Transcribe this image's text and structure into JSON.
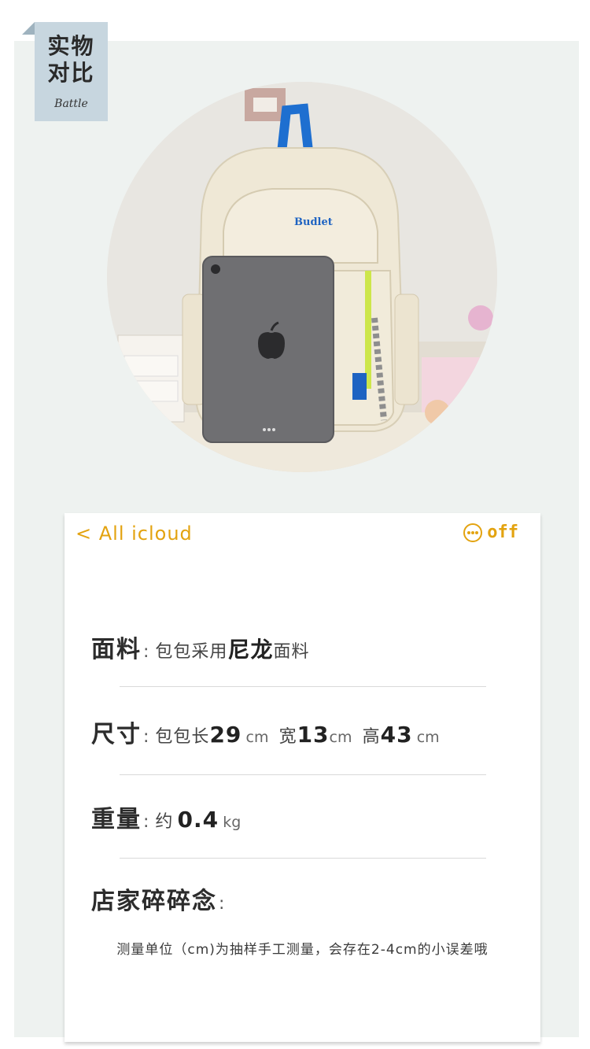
{
  "tag": {
    "title_line1": "实物",
    "title_line2": "对比",
    "subtitle": "Battle"
  },
  "nav": {
    "back_label": "< All icloud",
    "more_icon": "more-circle-icon",
    "off_label": "off"
  },
  "specs": {
    "material": {
      "label": "面料",
      "sep": ":",
      "text1": "包包采用",
      "highlight": "尼龙",
      "text2": "面料"
    },
    "size": {
      "label": "尺寸",
      "sep": ":",
      "length_label": "包包长",
      "length_value": "29",
      "length_unit": "cm",
      "width_label": "宽",
      "width_value": "13",
      "width_unit": "cm",
      "height_label": "高",
      "height_value": "43",
      "height_unit": "cm"
    },
    "weight": {
      "label": "重量",
      "sep": ":",
      "prefix": "约",
      "value": "0.4",
      "unit": "kg"
    },
    "notes": {
      "label": "店家碎碎念",
      "sep": ":"
    }
  },
  "note_text": "测量单位（cm)为抽样手工测量，会存在2-4cm的小误差哦",
  "colors": {
    "accent": "#e3a310",
    "tag_bg": "#c7d6df",
    "panel_bg": "#eef2f0"
  }
}
